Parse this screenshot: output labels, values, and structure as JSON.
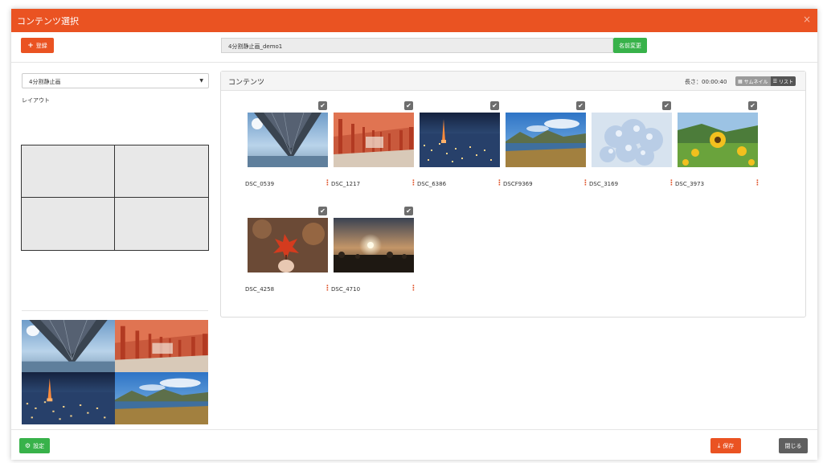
{
  "header": {
    "title": "コンテンツ選択",
    "close_label": "×"
  },
  "toolbar": {
    "register_label": "登録",
    "name_value": "4分割静止画_demo1",
    "rename_label": "名前変更"
  },
  "layout": {
    "selected": "4分割静止画",
    "label": "レイアウト"
  },
  "contents": {
    "title": "コンテンツ",
    "length_label": "長さ：00:00:40",
    "view_thumbnail_label": "サムネイル",
    "view_list_label": "リスト",
    "items": [
      {
        "name": "DSC_0539",
        "checked": true,
        "icon": "bridge-underside-photo"
      },
      {
        "name": "DSC_1217",
        "checked": true,
        "icon": "red-corridor-photo"
      },
      {
        "name": "DSC_6386",
        "checked": true,
        "icon": "night-city-photo"
      },
      {
        "name": "DSCF9369",
        "checked": true,
        "icon": "mountain-lake-photo"
      },
      {
        "name": "DSC_3169",
        "checked": true,
        "icon": "hydrangea-photo"
      },
      {
        "name": "DSC_3973",
        "checked": true,
        "icon": "sunflower-photo"
      },
      {
        "name": "DSC_4258",
        "checked": true,
        "icon": "autumn-leaf-photo"
      },
      {
        "name": "DSC_4710",
        "checked": true,
        "icon": "sunset-photo"
      }
    ]
  },
  "footer": {
    "settings_label": "設定",
    "save_label": "保存",
    "close_label": "閉じる"
  },
  "colors": {
    "accent": "#ea5322",
    "success": "#38b24a",
    "neutral": "#5f5f5f"
  }
}
